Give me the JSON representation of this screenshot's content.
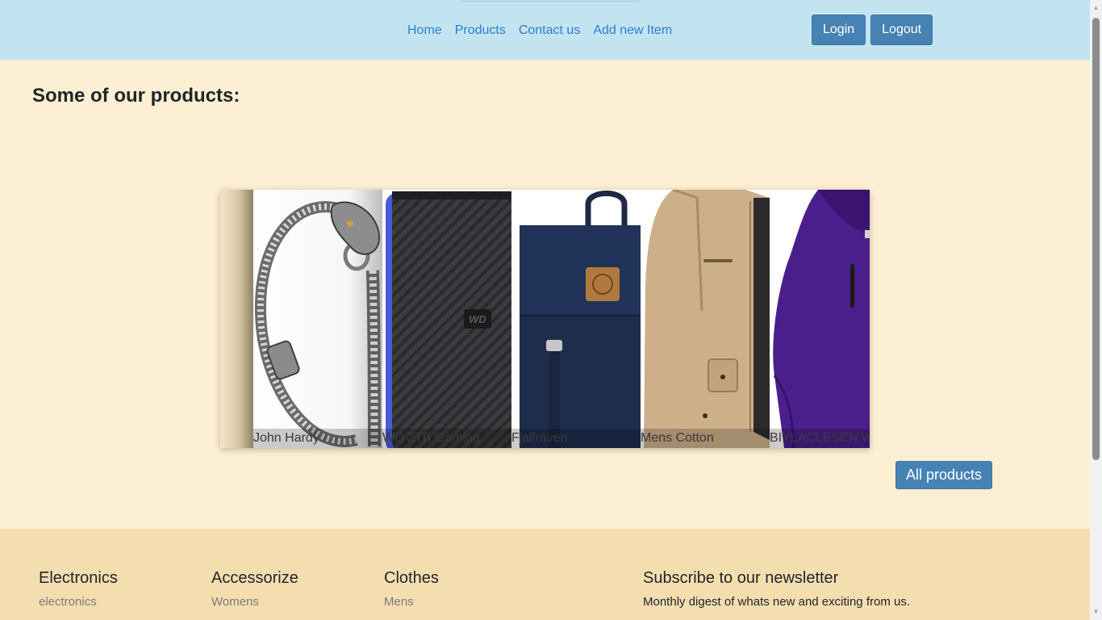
{
  "nav": {
    "links": [
      "Home",
      "Products",
      "Contact us",
      "Add new Item"
    ],
    "login_label": "Login",
    "logout_label": "Logout"
  },
  "main": {
    "title": "Some of our products:",
    "carousel": [
      {
        "caption": "John Hardy",
        "icon": "bracelet-image"
      },
      {
        "caption": "WD 2TB Gaming",
        "icon": "hard-drive-image"
      },
      {
        "caption": "Fjallraven",
        "icon": "backpack-image"
      },
      {
        "caption": "Mens Cotton",
        "icon": "jacket-image"
      },
      {
        "caption": "BIYLACLESEN Wo",
        "icon": "womens-jacket-image"
      }
    ],
    "all_products_label": "All products"
  },
  "footer": {
    "columns": [
      {
        "heading": "Electronics",
        "link": "electronics"
      },
      {
        "heading": "Accessorize",
        "link": "Womens"
      },
      {
        "heading": "Clothes",
        "link": "Mens"
      }
    ],
    "newsletter": {
      "heading": "Subscribe to our newsletter",
      "text": "Monthly digest of whats new and exciting from us."
    }
  },
  "colors": {
    "header_bg": "#c2e4f1",
    "page_bg": "#fdefd4",
    "footer_bg": "#f4deb0",
    "button": "#4682b4",
    "link": "#2a7fd2"
  }
}
